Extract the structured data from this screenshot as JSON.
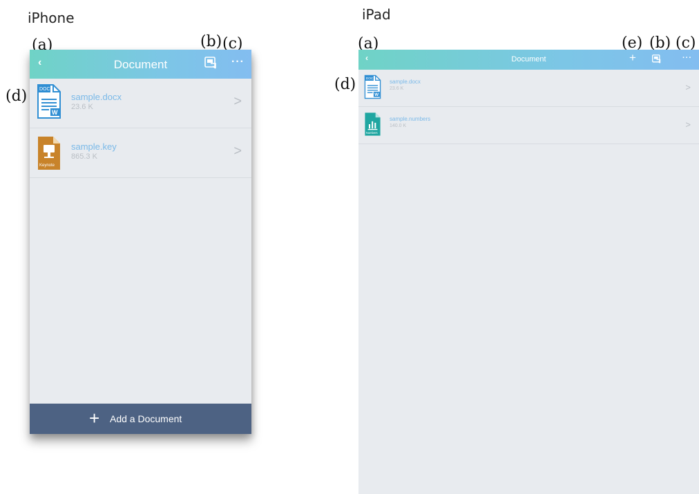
{
  "labels": {
    "iphone": "iPhone",
    "ipad": "iPad"
  },
  "callouts": {
    "a": "(a)",
    "b": "(b)",
    "c": "(c)",
    "d": "(d)",
    "e": "(e)"
  },
  "iphone_screen": {
    "nav": {
      "title": "Document",
      "back": "‹",
      "more": "···"
    },
    "files": [
      {
        "name": "sample.docx",
        "size": "23.6 K",
        "chevron": ">",
        "icon": "word-doc-icon"
      },
      {
        "name": "sample.key",
        "size": "865.3 K",
        "chevron": ">",
        "icon": "keynote-icon"
      }
    ],
    "add_bar": {
      "plus": "+",
      "label": "Add a Document"
    }
  },
  "ipad_screen": {
    "nav": {
      "title": "Document",
      "back": "‹",
      "more": "···",
      "plus": "+"
    },
    "files": [
      {
        "name": "sample.docx",
        "size": "23.6 K",
        "chevron": ">",
        "icon": "word-doc-icon"
      },
      {
        "name": "sample.numbers",
        "size": "140.0 K",
        "chevron": ">",
        "icon": "numbers-icon"
      }
    ]
  },
  "colors": {
    "nav_gradient_start": "#6fd3c6",
    "nav_gradient_end": "#83bdf0",
    "file_name": "#7ab9e8",
    "add_bar": "#4d6283",
    "background": "#e8ebef"
  },
  "icon_labels": {
    "doc": "DOC",
    "w": "W",
    "keynote": "Keynote",
    "numbers": "Numbers"
  }
}
